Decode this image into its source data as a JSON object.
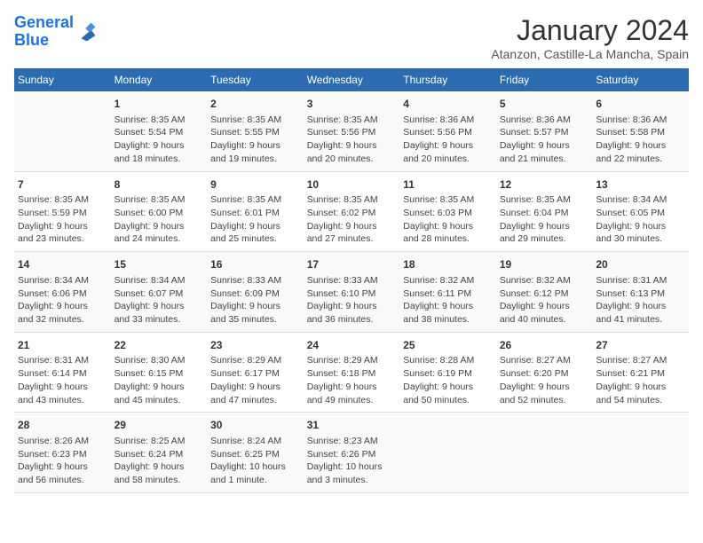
{
  "logo": {
    "line1": "General",
    "line2": "Blue"
  },
  "title": "January 2024",
  "subtitle": "Atanzon, Castille-La Mancha, Spain",
  "days_header": [
    "Sunday",
    "Monday",
    "Tuesday",
    "Wednesday",
    "Thursday",
    "Friday",
    "Saturday"
  ],
  "weeks": [
    [
      {
        "num": "",
        "info": ""
      },
      {
        "num": "1",
        "info": "Sunrise: 8:35 AM\nSunset: 5:54 PM\nDaylight: 9 hours\nand 18 minutes."
      },
      {
        "num": "2",
        "info": "Sunrise: 8:35 AM\nSunset: 5:55 PM\nDaylight: 9 hours\nand 19 minutes."
      },
      {
        "num": "3",
        "info": "Sunrise: 8:35 AM\nSunset: 5:56 PM\nDaylight: 9 hours\nand 20 minutes."
      },
      {
        "num": "4",
        "info": "Sunrise: 8:36 AM\nSunset: 5:56 PM\nDaylight: 9 hours\nand 20 minutes."
      },
      {
        "num": "5",
        "info": "Sunrise: 8:36 AM\nSunset: 5:57 PM\nDaylight: 9 hours\nand 21 minutes."
      },
      {
        "num": "6",
        "info": "Sunrise: 8:36 AM\nSunset: 5:58 PM\nDaylight: 9 hours\nand 22 minutes."
      }
    ],
    [
      {
        "num": "7",
        "info": "Sunrise: 8:35 AM\nSunset: 5:59 PM\nDaylight: 9 hours\nand 23 minutes."
      },
      {
        "num": "8",
        "info": "Sunrise: 8:35 AM\nSunset: 6:00 PM\nDaylight: 9 hours\nand 24 minutes."
      },
      {
        "num": "9",
        "info": "Sunrise: 8:35 AM\nSunset: 6:01 PM\nDaylight: 9 hours\nand 25 minutes."
      },
      {
        "num": "10",
        "info": "Sunrise: 8:35 AM\nSunset: 6:02 PM\nDaylight: 9 hours\nand 27 minutes."
      },
      {
        "num": "11",
        "info": "Sunrise: 8:35 AM\nSunset: 6:03 PM\nDaylight: 9 hours\nand 28 minutes."
      },
      {
        "num": "12",
        "info": "Sunrise: 8:35 AM\nSunset: 6:04 PM\nDaylight: 9 hours\nand 29 minutes."
      },
      {
        "num": "13",
        "info": "Sunrise: 8:34 AM\nSunset: 6:05 PM\nDaylight: 9 hours\nand 30 minutes."
      }
    ],
    [
      {
        "num": "14",
        "info": "Sunrise: 8:34 AM\nSunset: 6:06 PM\nDaylight: 9 hours\nand 32 minutes."
      },
      {
        "num": "15",
        "info": "Sunrise: 8:34 AM\nSunset: 6:07 PM\nDaylight: 9 hours\nand 33 minutes."
      },
      {
        "num": "16",
        "info": "Sunrise: 8:33 AM\nSunset: 6:09 PM\nDaylight: 9 hours\nand 35 minutes."
      },
      {
        "num": "17",
        "info": "Sunrise: 8:33 AM\nSunset: 6:10 PM\nDaylight: 9 hours\nand 36 minutes."
      },
      {
        "num": "18",
        "info": "Sunrise: 8:32 AM\nSunset: 6:11 PM\nDaylight: 9 hours\nand 38 minutes."
      },
      {
        "num": "19",
        "info": "Sunrise: 8:32 AM\nSunset: 6:12 PM\nDaylight: 9 hours\nand 40 minutes."
      },
      {
        "num": "20",
        "info": "Sunrise: 8:31 AM\nSunset: 6:13 PM\nDaylight: 9 hours\nand 41 minutes."
      }
    ],
    [
      {
        "num": "21",
        "info": "Sunrise: 8:31 AM\nSunset: 6:14 PM\nDaylight: 9 hours\nand 43 minutes."
      },
      {
        "num": "22",
        "info": "Sunrise: 8:30 AM\nSunset: 6:15 PM\nDaylight: 9 hours\nand 45 minutes."
      },
      {
        "num": "23",
        "info": "Sunrise: 8:29 AM\nSunset: 6:17 PM\nDaylight: 9 hours\nand 47 minutes."
      },
      {
        "num": "24",
        "info": "Sunrise: 8:29 AM\nSunset: 6:18 PM\nDaylight: 9 hours\nand 49 minutes."
      },
      {
        "num": "25",
        "info": "Sunrise: 8:28 AM\nSunset: 6:19 PM\nDaylight: 9 hours\nand 50 minutes."
      },
      {
        "num": "26",
        "info": "Sunrise: 8:27 AM\nSunset: 6:20 PM\nDaylight: 9 hours\nand 52 minutes."
      },
      {
        "num": "27",
        "info": "Sunrise: 8:27 AM\nSunset: 6:21 PM\nDaylight: 9 hours\nand 54 minutes."
      }
    ],
    [
      {
        "num": "28",
        "info": "Sunrise: 8:26 AM\nSunset: 6:23 PM\nDaylight: 9 hours\nand 56 minutes."
      },
      {
        "num": "29",
        "info": "Sunrise: 8:25 AM\nSunset: 6:24 PM\nDaylight: 9 hours\nand 58 minutes."
      },
      {
        "num": "30",
        "info": "Sunrise: 8:24 AM\nSunset: 6:25 PM\nDaylight: 10 hours\nand 1 minute."
      },
      {
        "num": "31",
        "info": "Sunrise: 8:23 AM\nSunset: 6:26 PM\nDaylight: 10 hours\nand 3 minutes."
      },
      {
        "num": "",
        "info": ""
      },
      {
        "num": "",
        "info": ""
      },
      {
        "num": "",
        "info": ""
      }
    ]
  ]
}
